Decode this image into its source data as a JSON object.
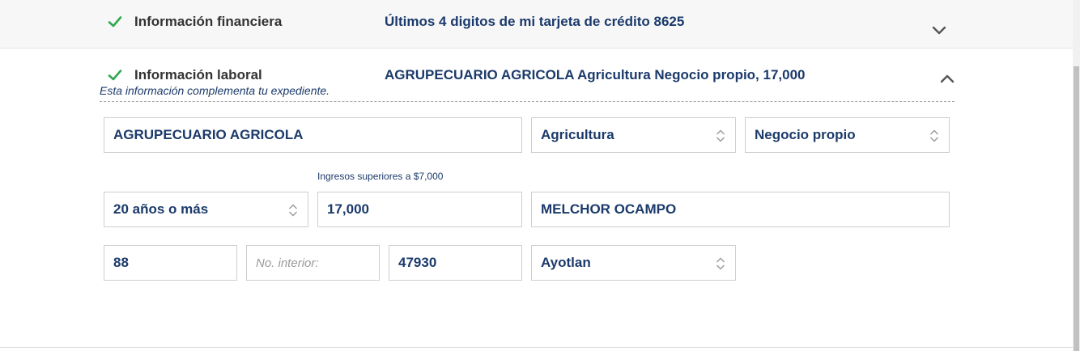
{
  "colors": {
    "check_green": "#2fa84f",
    "text_blue": "#1b3a6b",
    "title_gray": "#333333",
    "border": "#cfcfcf"
  },
  "sections": {
    "financiera": {
      "title": "Información financiera",
      "summary": "Últimos 4 digitos de mi tarjeta de crédito 8625",
      "status_icon": "check-icon",
      "toggle_icon": "chevron-down-icon"
    },
    "laboral": {
      "title": "Información laboral",
      "summary": "AGRUPECUARIO AGRICOLA Agricultura Negocio propio, 17,000",
      "status_icon": "check-icon",
      "toggle_icon": "chevron-up-icon",
      "note": "Esta información complementa tu expediente."
    }
  },
  "form": {
    "company_name": "AGRUPECUARIO AGRICOLA",
    "sector": "Agricultura",
    "employment_type": "Negocio propio",
    "seniority": "20 años o más",
    "income_helper": "Ingresos superiores a $7,000",
    "income": "17,000",
    "street": "MELCHOR OCAMPO",
    "ext_number": "88",
    "int_number_placeholder": "No. interior:",
    "zip_code": "47930",
    "municipality": "Ayotlan",
    "select_icon": "select-arrows-icon"
  }
}
